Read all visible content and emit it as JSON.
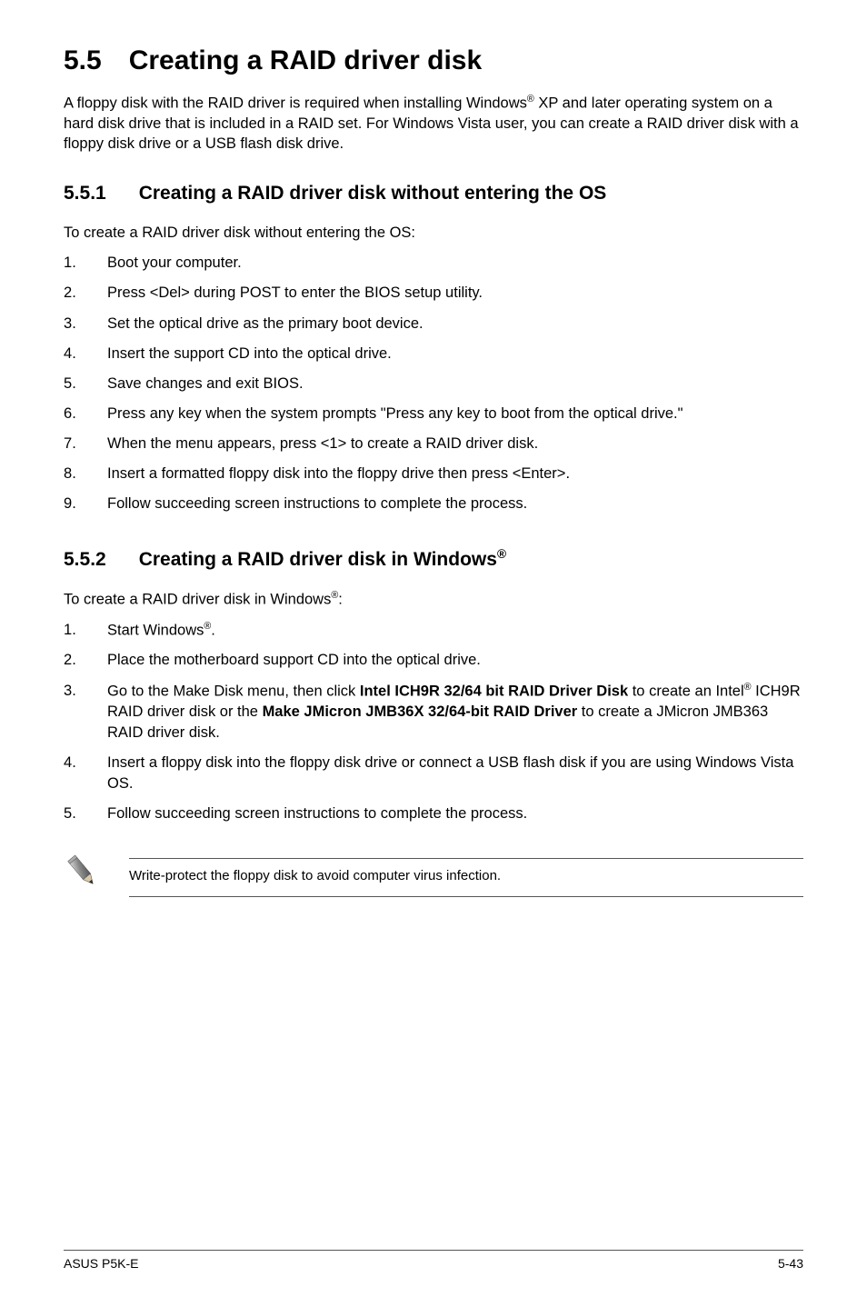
{
  "heading": {
    "number": "5.5",
    "title": "Creating a RAID driver disk"
  },
  "intro": {
    "prefix": "A floppy disk with the RAID driver is required when installing Windows",
    "sup": "®",
    "suffix": " XP and later operating system on a hard disk drive that is included in a RAID set. For Windows Vista user, you can create a RAID driver disk with a floppy disk drive or a USB flash disk drive."
  },
  "sub1": {
    "number": "5.5.1",
    "title": "Creating a RAID driver disk without entering the OS",
    "lead": "To create a RAID driver disk without entering the OS:",
    "steps": [
      "Boot your computer.",
      "Press <Del> during POST to enter the BIOS setup utility.",
      "Set the optical drive as the primary boot device.",
      "Insert the support CD into the optical drive.",
      "Save changes and exit BIOS.",
      "Press any key when the system prompts \"Press any key to boot from the optical drive.\"",
      "When the menu appears, press <1> to create a RAID driver disk.",
      "Insert a formatted floppy disk into the floppy drive then press <Enter>.",
      "Follow succeeding screen instructions to complete the process."
    ]
  },
  "sub2": {
    "number": "5.5.2",
    "title_prefix": "Creating a RAID driver disk in Windows",
    "title_sup": "®",
    "lead_prefix": "To create a RAID driver disk in Windows",
    "lead_sup": "®",
    "lead_suffix": ":",
    "step1_prefix": "Start Windows",
    "step1_sup": "®",
    "step1_suffix": ".",
    "step2": "Place the motherboard support CD into the optical drive.",
    "step3_a": "Go to the Make Disk menu, then click ",
    "step3_bold1": "Intel ICH9R 32/64 bit RAID Driver Disk",
    "step3_b": " to create an Intel",
    "step3_sup": "®",
    "step3_c": " ICH9R RAID driver disk or the ",
    "step3_bold2": "Make JMicron JMB36X 32/64-bit RAID Driver",
    "step3_d": " to create a JMicron JMB363 RAID driver disk.",
    "step4": "Insert a floppy disk into the floppy disk drive or connect a USB flash disk if you are using Windows Vista OS.",
    "step5": "Follow succeeding screen instructions to complete the process."
  },
  "note": "Write-protect the floppy disk to avoid computer virus infection.",
  "footer": {
    "left": "ASUS P5K-E",
    "right": "5-43"
  }
}
